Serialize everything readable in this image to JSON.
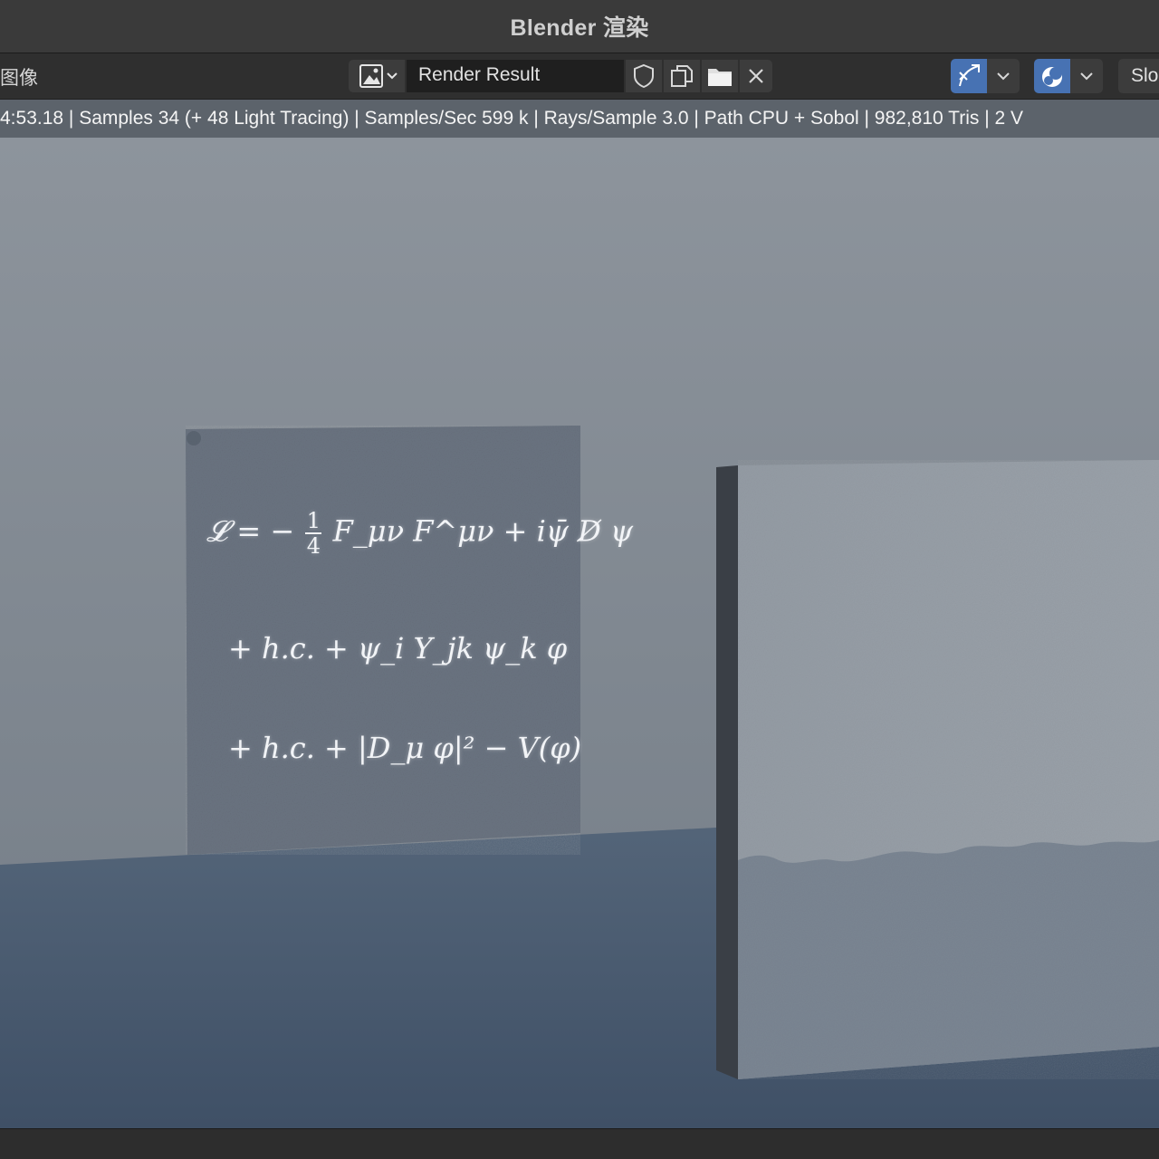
{
  "window": {
    "title": "Blender 渲染"
  },
  "header": {
    "menu_image": "图像",
    "image_name": "Render Result",
    "slot_label": "Slo"
  },
  "stats": {
    "text": "4:53.18 | Samples 34 (+ 48 Light Tracing) | Samples/Sec 599 k | Rays/Sample 3.0 | Path CPU + Sobol | 982,810 Tris | 2 V"
  },
  "formula": {
    "line1_lhs": "𝓛 = −",
    "line1_num": "1",
    "line1_den": "4",
    "line1_rhs": "F_μν F^μν + iψ̄ D̸ ψ",
    "line2": "+ h.c. + ψ_i Y_jk ψ_k φ",
    "line3": "+ h.c. + |D_μ φ|² − V(φ)"
  },
  "icons": {
    "browse": "image-browse-icon",
    "fake_user": "shield-icon",
    "duplicate": "duplicate-icon",
    "open": "folder-icon",
    "unlink": "close-icon",
    "gizmo": "gizmo-icon",
    "overlay": "overlay-icon"
  },
  "colors": {
    "accent": "#4772b3",
    "stats_bar": "#5c636b",
    "header": "#2f2f2f",
    "title_bar": "#3a3a3a"
  }
}
